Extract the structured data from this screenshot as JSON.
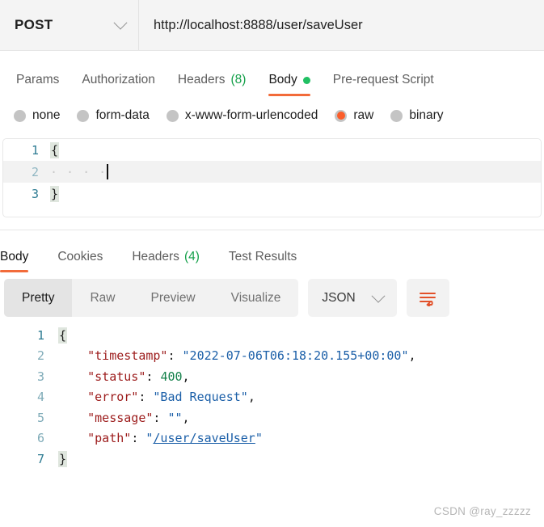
{
  "request_bar": {
    "method": "POST",
    "method_caret_icon": "chevron-down-icon",
    "url": "http://localhost:8888/user/saveUser"
  },
  "request_tabs": [
    {
      "label": "Params",
      "count": "",
      "active": false,
      "dot": false
    },
    {
      "label": "Authorization",
      "count": "",
      "active": false,
      "dot": false
    },
    {
      "label": "Headers",
      "count": "(8)",
      "active": false,
      "dot": false
    },
    {
      "label": "Body",
      "count": "",
      "active": true,
      "dot": true
    },
    {
      "label": "Pre-request Script",
      "count": "",
      "active": false,
      "dot": false
    }
  ],
  "body_types": [
    {
      "label": "none",
      "selected": false
    },
    {
      "label": "form-data",
      "selected": false
    },
    {
      "label": "x-www-form-urlencoded",
      "selected": false
    },
    {
      "label": "raw",
      "selected": true
    },
    {
      "label": "binary",
      "selected": false
    }
  ],
  "request_editor": {
    "lines": [
      {
        "no": "1",
        "text": "{",
        "kind": "brace",
        "active": false
      },
      {
        "no": "2",
        "text": "    ",
        "kind": "indent",
        "active": true
      },
      {
        "no": "3",
        "text": "}",
        "kind": "brace",
        "active": false
      }
    ]
  },
  "response_tabs": [
    {
      "label": "Body",
      "count": "",
      "active": true
    },
    {
      "label": "Cookies",
      "count": "",
      "active": false
    },
    {
      "label": "Headers",
      "count": "(4)",
      "active": false
    },
    {
      "label": "Test Results",
      "count": "",
      "active": false
    }
  ],
  "view_toolbar": {
    "segments": [
      {
        "label": "Pretty",
        "active": true
      },
      {
        "label": "Raw",
        "active": false
      },
      {
        "label": "Preview",
        "active": false
      },
      {
        "label": "Visualize",
        "active": false
      }
    ],
    "format": "JSON",
    "format_caret_icon": "chevron-down-icon",
    "wrap_icon": "word-wrap-icon"
  },
  "response_body": {
    "lines": [
      {
        "no": "1",
        "segments": [
          {
            "t": "{",
            "c": "brace"
          }
        ]
      },
      {
        "no": "2",
        "segments": [
          {
            "t": "    ",
            "c": "p"
          },
          {
            "t": "\"timestamp\"",
            "c": "k"
          },
          {
            "t": ": ",
            "c": "p"
          },
          {
            "t": "\"2022-07-06T06:18:20.155+00:00\"",
            "c": "s"
          },
          {
            "t": ",",
            "c": "p"
          }
        ]
      },
      {
        "no": "3",
        "segments": [
          {
            "t": "    ",
            "c": "p"
          },
          {
            "t": "\"status\"",
            "c": "k"
          },
          {
            "t": ": ",
            "c": "p"
          },
          {
            "t": "400",
            "c": "n"
          },
          {
            "t": ",",
            "c": "p"
          }
        ]
      },
      {
        "no": "4",
        "segments": [
          {
            "t": "    ",
            "c": "p"
          },
          {
            "t": "\"error\"",
            "c": "k"
          },
          {
            "t": ": ",
            "c": "p"
          },
          {
            "t": "\"Bad Request\"",
            "c": "s"
          },
          {
            "t": ",",
            "c": "p"
          }
        ]
      },
      {
        "no": "5",
        "segments": [
          {
            "t": "    ",
            "c": "p"
          },
          {
            "t": "\"message\"",
            "c": "k"
          },
          {
            "t": ": ",
            "c": "p"
          },
          {
            "t": "\"\"",
            "c": "s"
          },
          {
            "t": ",",
            "c": "p"
          }
        ]
      },
      {
        "no": "6",
        "segments": [
          {
            "t": "    ",
            "c": "p"
          },
          {
            "t": "\"path\"",
            "c": "k"
          },
          {
            "t": ": ",
            "c": "p"
          },
          {
            "t": "\"",
            "c": "s"
          },
          {
            "t": "/user/saveUser",
            "c": "lnk"
          },
          {
            "t": "\"",
            "c": "s"
          }
        ]
      },
      {
        "no": "7",
        "segments": [
          {
            "t": "}",
            "c": "brace"
          }
        ]
      }
    ]
  },
  "watermark": "CSDN @ray_zzzzz",
  "colors": {
    "accent_orange": "#f26b3a",
    "radio_selected": "#fb5d2a",
    "dot_green": "#21c063",
    "count_green": "#15a04a",
    "gutter_teal": "#2d7b92",
    "json_key": "#9c1b1b",
    "json_string": "#1b5fa8",
    "json_number": "#13804a"
  }
}
